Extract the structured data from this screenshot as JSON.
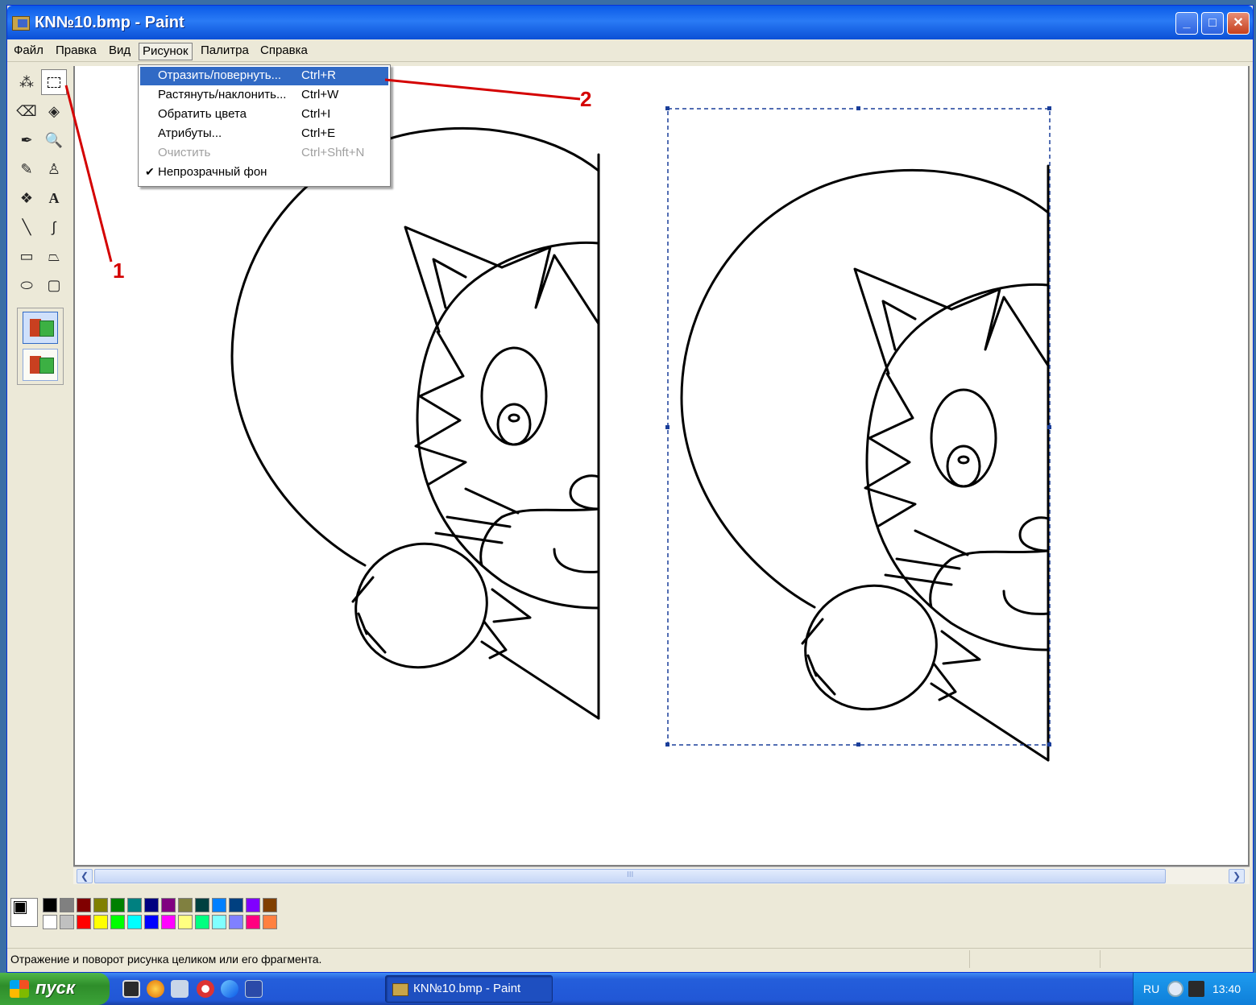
{
  "window": {
    "title": "КN№10.bmp - Paint"
  },
  "menubar": {
    "items": [
      "Файл",
      "Правка",
      "Вид",
      "Рисунок",
      "Палитра",
      "Справка"
    ],
    "active_index": 3
  },
  "dropdown": {
    "items": [
      {
        "label": "Отразить/повернуть...",
        "shortcut": "Ctrl+R",
        "highlighted": true
      },
      {
        "label": "Растянуть/наклонить...",
        "shortcut": "Ctrl+W"
      },
      {
        "label": "Обратить цвета",
        "shortcut": "Ctrl+I"
      },
      {
        "label": "Атрибуты...",
        "shortcut": "Ctrl+E"
      },
      {
        "label": "Очистить",
        "shortcut": "Ctrl+Shft+N",
        "disabled": true
      },
      {
        "label": "Непрозрачный фон",
        "shortcut": "",
        "checked": true
      }
    ]
  },
  "toolbox": {
    "tools": [
      "free-select-icon",
      "rect-select-icon",
      "eraser-icon",
      "fill-icon",
      "color-picker-icon",
      "magnifier-icon",
      "pencil-icon",
      "brush-icon",
      "airbrush-icon",
      "text-icon",
      "line-icon",
      "curve-icon",
      "rectangle-icon",
      "polygon-icon",
      "ellipse-icon",
      "rounded-rect-icon"
    ],
    "selected": "rect-select-icon"
  },
  "annotations": {
    "label_1": "1",
    "label_2": "2",
    "color": "#d40000"
  },
  "palette": {
    "foreground": "#000000",
    "background": "#ffffff",
    "row1": [
      "#000000",
      "#808080",
      "#800000",
      "#808000",
      "#008000",
      "#008080",
      "#000080",
      "#800080",
      "#808040",
      "#004040",
      "#0080ff",
      "#004080",
      "#8000ff",
      "#804000"
    ],
    "row2": [
      "#ffffff",
      "#c0c0c0",
      "#ff0000",
      "#ffff00",
      "#00ff00",
      "#00ffff",
      "#0000ff",
      "#ff00ff",
      "#ffff80",
      "#00ff80",
      "#80ffff",
      "#8080ff",
      "#ff0080",
      "#ff8040"
    ]
  },
  "hscroll": {
    "grip": "III"
  },
  "statusbar": {
    "text": "Отражение и поворот рисунка целиком или его фрагмента."
  },
  "taskbar": {
    "start": "пуск",
    "task": "КN№10.bmp - Paint",
    "lang": "RU",
    "clock": "13:40"
  }
}
